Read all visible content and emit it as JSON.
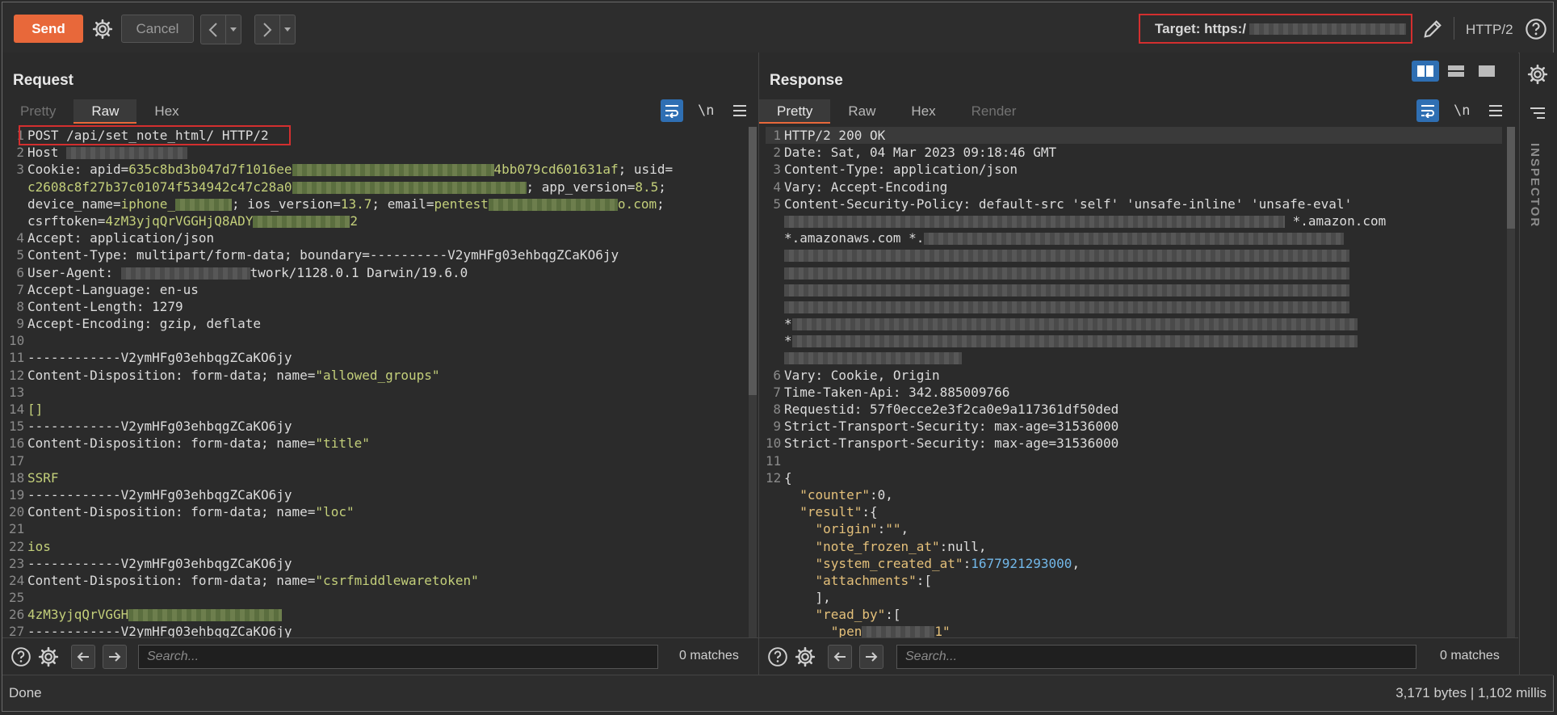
{
  "toolbar": {
    "send_label": "Send",
    "cancel_label": "Cancel",
    "target_label": "Target: https:/",
    "protocol": "HTTP/2"
  },
  "request": {
    "title": "Request",
    "tabs": [
      "Pretty",
      "Raw",
      "Hex"
    ],
    "wrap_label": "\\n",
    "lines": [
      [
        {
          "t": "POST /api/set_note_html/ HTTP/2",
          "c": "k"
        }
      ],
      [
        {
          "t": "Host ",
          "c": "k"
        },
        {
          "r": 150,
          "g": false
        }
      ],
      [
        {
          "t": "Cookie: ",
          "c": "k"
        },
        {
          "t": "apid",
          "c": "k"
        },
        {
          "t": "=",
          "c": "k"
        },
        {
          "t": "635c8bd3b047d7f1016ee",
          "c": "v"
        },
        {
          "r": 250,
          "g": true
        },
        {
          "t": "4bb079cd601631af",
          "c": "v"
        },
        {
          "t": "; usid=",
          "c": "k"
        }
      ],
      [
        {
          "t": "c2608c8f27b37c01074f534942c47c28a0",
          "c": "v"
        },
        {
          "r": 290,
          "g": true
        },
        {
          "t": "; app_version=",
          "c": "k"
        },
        {
          "t": "8.5",
          "c": "v"
        },
        {
          "t": ";",
          "c": "k"
        }
      ],
      [
        {
          "t": "device_name=",
          "c": "k"
        },
        {
          "t": "iphone_",
          "c": "v"
        },
        {
          "r": 70,
          "g": true
        },
        {
          "t": "; ios_version=",
          "c": "k"
        },
        {
          "t": "13.7",
          "c": "v"
        },
        {
          "t": "; email=",
          "c": "k"
        },
        {
          "t": "pentest",
          "c": "v"
        },
        {
          "r": 160,
          "g": true
        },
        {
          "t": "o.com",
          "c": "v"
        },
        {
          "t": ";",
          "c": "k"
        }
      ],
      [
        {
          "t": "csrftoken=",
          "c": "k"
        },
        {
          "t": "4zM3yjqQrVGGHjQ8ADY",
          "c": "v"
        },
        {
          "r": 120,
          "g": true
        },
        {
          "t": "2",
          "c": "v"
        }
      ],
      [
        {
          "t": "Accept: application/json",
          "c": "k"
        }
      ],
      [
        {
          "t": "Content-Type: multipart/form-data; boundary=----------V2ymHFg03ehbqgZCaKO6jy",
          "c": "k"
        }
      ],
      [
        {
          "t": "User-Agent: ",
          "c": "k"
        },
        {
          "r": 160,
          "g": false
        },
        {
          "t": "twork/1128.0.1 Darwin/19.6.0",
          "c": "k"
        }
      ],
      [
        {
          "t": "Accept-Language: en-us",
          "c": "k"
        }
      ],
      [
        {
          "t": "Content-Length: 1279",
          "c": "k"
        }
      ],
      [
        {
          "t": "Accept-Encoding: gzip, deflate",
          "c": "k"
        }
      ],
      [],
      [
        {
          "t": "------------V2ymHFg03ehbqgZCaKO6jy",
          "c": "k"
        }
      ],
      [
        {
          "t": "Content-Disposition: form-data; name=",
          "c": "k"
        },
        {
          "t": "\"allowed_groups\"",
          "c": "s"
        }
      ],
      [],
      [
        {
          "t": "[]",
          "c": "v"
        }
      ],
      [
        {
          "t": "------------V2ymHFg03ehbqgZCaKO6jy",
          "c": "k"
        }
      ],
      [
        {
          "t": "Content-Disposition: form-data; name=",
          "c": "k"
        },
        {
          "t": "\"title\"",
          "c": "s"
        }
      ],
      [],
      [
        {
          "t": "SSRF",
          "c": "v"
        }
      ],
      [
        {
          "t": "------------V2ymHFg03ehbqgZCaKO6jy",
          "c": "k"
        }
      ],
      [
        {
          "t": "Content-Disposition: form-data; name=",
          "c": "k"
        },
        {
          "t": "\"loc\"",
          "c": "s"
        }
      ],
      [],
      [
        {
          "t": "ios",
          "c": "v"
        }
      ],
      [
        {
          "t": "------------V2ymHFg03ehbqgZCaKO6jy",
          "c": "k"
        }
      ],
      [
        {
          "t": "Content-Disposition: form-data; name=",
          "c": "k"
        },
        {
          "t": "\"csrfmiddlewaretoken\"",
          "c": "s"
        }
      ],
      [],
      [
        {
          "t": "4zM3yjqQrVGGH",
          "c": "v"
        },
        {
          "r": 190,
          "g": true
        }
      ],
      [
        {
          "t": "------------V2ymHFg03ehbqgZCaKO6jy",
          "c": "k"
        }
      ]
    ],
    "line_numbers": [
      "1",
      "2",
      "3",
      "",
      "",
      "",
      "4",
      "5",
      "6",
      "7",
      "8",
      "9",
      "10",
      "11",
      "12",
      "13",
      "14",
      "15",
      "16",
      "17",
      "18",
      "19",
      "20",
      "21",
      "22",
      "23",
      "24",
      "25",
      "26",
      "27"
    ],
    "search_placeholder": "Search...",
    "matches": "0 matches"
  },
  "response": {
    "title": "Response",
    "tabs": [
      "Pretty",
      "Raw",
      "Hex",
      "Render"
    ],
    "wrap_label": "\\n",
    "lines": [
      [
        {
          "t": "HTTP/2 200 OK",
          "c": "k"
        }
      ],
      [
        {
          "t": "Date: Sat, 04 Mar 2023 09:18:46 GMT",
          "c": "k"
        }
      ],
      [
        {
          "t": "Content-Type: application/json",
          "c": "k"
        }
      ],
      [
        {
          "t": "Vary: Accept-Encoding",
          "c": "k"
        }
      ],
      [
        {
          "t": "Content-Security-Policy: default-src 'self' 'unsafe-inline' 'unsafe-eval'",
          "c": "k"
        }
      ],
      [
        {
          "r": 620,
          "g": false
        },
        {
          "t": " *.amazon.com",
          "c": "k"
        }
      ],
      [
        {
          "t": "*.amazonaws.com *.",
          "c": "k"
        },
        {
          "r": 520,
          "g": false
        }
      ],
      [
        {
          "r": 700,
          "g": false
        }
      ],
      [
        {
          "r": 700,
          "g": false
        }
      ],
      [
        {
          "r": 700,
          "g": false
        }
      ],
      [
        {
          "r": 700,
          "g": false
        }
      ],
      [
        {
          "t": "*",
          "c": "k"
        },
        {
          "r": 700,
          "g": false
        }
      ],
      [
        {
          "t": "*",
          "c": "k"
        },
        {
          "r": 700,
          "g": false
        }
      ],
      [
        {
          "r": 220,
          "g": false
        }
      ],
      [
        {
          "t": "Vary: Cookie, Origin",
          "c": "k"
        }
      ],
      [
        {
          "t": "Time-Taken-Api: 342.885009766",
          "c": "k"
        }
      ],
      [
        {
          "t": "Requestid: 57f0ecce2e3f2ca0e9a117361df50ded",
          "c": "k"
        }
      ],
      [
        {
          "t": "Strict-Transport-Security: max-age=31536000",
          "c": "k"
        }
      ],
      [
        {
          "t": "Strict-Transport-Security: max-age=31536000",
          "c": "k"
        }
      ],
      [],
      [
        {
          "t": "{",
          "c": "k"
        }
      ],
      [
        {
          "t": "  ",
          "c": "k"
        },
        {
          "t": "\"counter\"",
          "c": "str"
        },
        {
          "t": ":0,",
          "c": "k"
        }
      ],
      [
        {
          "t": "  ",
          "c": "k"
        },
        {
          "t": "\"result\"",
          "c": "str"
        },
        {
          "t": ":{",
          "c": "k"
        }
      ],
      [
        {
          "t": "    ",
          "c": "k"
        },
        {
          "t": "\"origin\"",
          "c": "str"
        },
        {
          "t": ":",
          "c": "k"
        },
        {
          "t": "\"\"",
          "c": "str"
        },
        {
          "t": ",",
          "c": "k"
        }
      ],
      [
        {
          "t": "    ",
          "c": "k"
        },
        {
          "t": "\"note_frozen_at\"",
          "c": "str"
        },
        {
          "t": ":null,",
          "c": "k"
        }
      ],
      [
        {
          "t": "    ",
          "c": "k"
        },
        {
          "t": "\"system_created_at\"",
          "c": "str"
        },
        {
          "t": ":",
          "c": "k"
        },
        {
          "t": "1677921293000",
          "c": "num"
        },
        {
          "t": ",",
          "c": "k"
        }
      ],
      [
        {
          "t": "    ",
          "c": "k"
        },
        {
          "t": "\"attachments\"",
          "c": "str"
        },
        {
          "t": ":[",
          "c": "k"
        }
      ],
      [
        {
          "t": "    ],",
          "c": "k"
        }
      ],
      [
        {
          "t": "    ",
          "c": "k"
        },
        {
          "t": "\"read_by\"",
          "c": "str"
        },
        {
          "t": ":[",
          "c": "k"
        }
      ],
      [
        {
          "t": "      ",
          "c": "k"
        },
        {
          "t": "\"pen",
          "c": "str"
        },
        {
          "r": 90,
          "g": false
        },
        {
          "t": "1\"",
          "c": "str"
        }
      ]
    ],
    "line_numbers": [
      "1",
      "2",
      "3",
      "4",
      "5",
      "",
      "",
      "",
      "",
      "",
      "",
      "",
      "",
      "",
      "6",
      "7",
      "8",
      "9",
      "10",
      "11",
      "12",
      "",
      "",
      "",
      "",
      "",
      "",
      "",
      "",
      ""
    ],
    "search_placeholder": "Search...",
    "matches": "0 matches"
  },
  "inspector_label": "INSPECTOR",
  "status": {
    "left": "Done",
    "right": "3,171 bytes | 1,102 millis"
  }
}
